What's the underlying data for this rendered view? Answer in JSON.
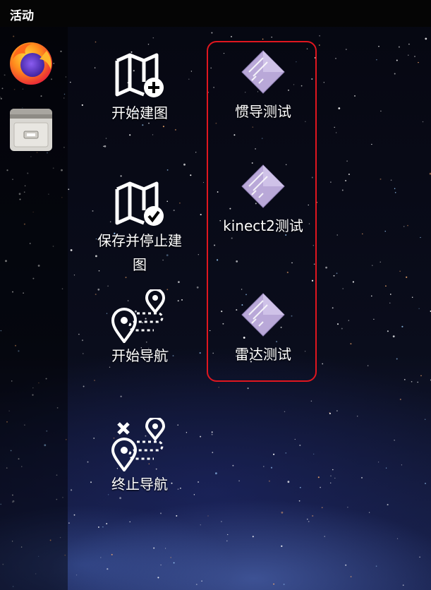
{
  "topbar": {
    "activities_label": "活动"
  },
  "dock": {
    "items": [
      {
        "icon": "firefox-icon"
      },
      {
        "icon": "file-cabinet-icon"
      }
    ]
  },
  "desktop": {
    "left_column": [
      {
        "label": "开始建图",
        "icon": "map-plus-icon"
      },
      {
        "label": "保存并停止建图",
        "icon": "map-check-icon"
      },
      {
        "label": "开始导航",
        "icon": "route-pins-icon"
      },
      {
        "label": "终止导航",
        "icon": "route-stop-icon"
      }
    ],
    "right_column": [
      {
        "label": "惯导测试",
        "icon": "script-diamond-icon"
      },
      {
        "label": "kinect2测试",
        "icon": "script-diamond-icon"
      },
      {
        "label": "雷达测试",
        "icon": "script-diamond-icon"
      }
    ],
    "highlight_color": "#e0161f",
    "script_icon_color": "#b9a8d8"
  }
}
